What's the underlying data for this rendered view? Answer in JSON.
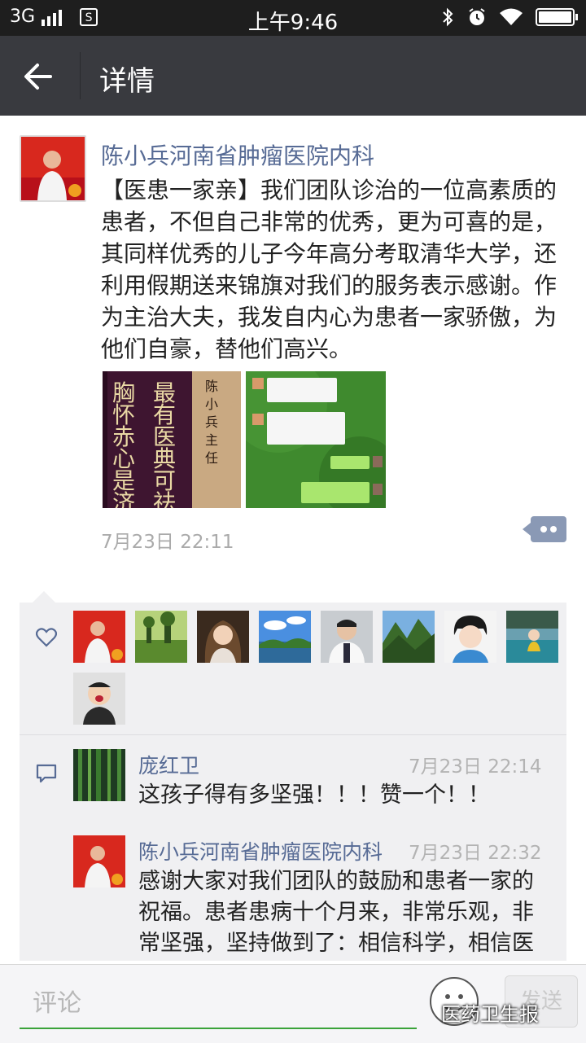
{
  "status_bar": {
    "network": "3G",
    "time": "上午9:46"
  },
  "title_bar": {
    "title": "详情"
  },
  "post": {
    "author": "陈小兵河南省肿瘤医院内科",
    "text": "【医患一家亲】我们团队诊治的一位高素质的患者，不但自己非常的优秀，更为可喜的是，其同样优秀的儿子今年高分考取清华大学，还利用假期送来锦旗对我们的服务表示感谢。作为主治大夫，我发自内心为患者一家骄傲，为他们自豪，替他们高兴。",
    "time": "7月23日 22:11",
    "banner_chars": [
      "胸",
      "怀",
      "赤",
      "心",
      "是",
      "济",
      "最",
      "有",
      "医",
      "典",
      "可",
      "祛"
    ],
    "banner_small": "陈小兵主任"
  },
  "likes": {
    "count": 9
  },
  "comments": [
    {
      "name": "庞红卫",
      "time": "7月23日 22:14",
      "text": "这孩子得有多坚强！！！赞一个！！"
    },
    {
      "name": "陈小兵河南省肿瘤医院内科",
      "time": "7月23日 22:32",
      "lines": [
        "感谢大家对我们团队的鼓励和患者一家的",
        "祝福。患者患病十个月来，非常乐观，非",
        "常坚强，坚持做到了：相信科学，相信医"
      ]
    }
  ],
  "comment_bar": {
    "placeholder": "评论",
    "send_label": "发送"
  },
  "watermark": "医药卫生报",
  "colors": {
    "link": "#576b95",
    "titlebar": "#393a3f",
    "statusbar": "#1e1e1e",
    "accent": "#3aa33a"
  }
}
